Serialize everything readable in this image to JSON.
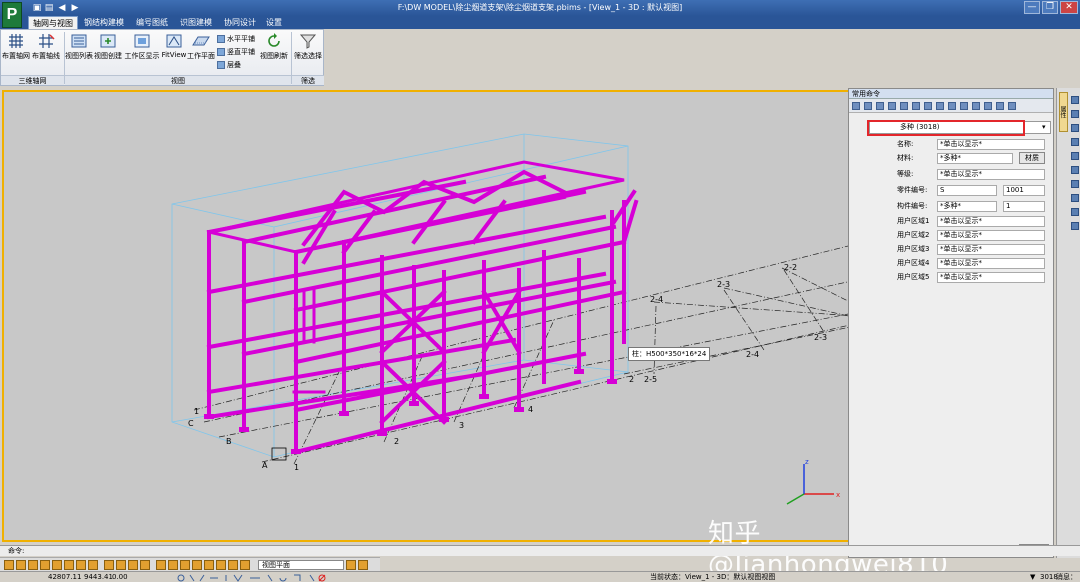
{
  "window": {
    "title": "F:\\DW MODEL\\除尘烟道支架\\除尘烟道支架.pbims - [View_1 - 3D : 默认视图]",
    "logo_letter": "P",
    "minimize": "—",
    "restore": "❐",
    "close": "✕"
  },
  "menu": {
    "tabs": [
      "轴网与视图",
      "钢结构建模",
      "编号图纸",
      "识图建模",
      "协同设计",
      "设置"
    ]
  },
  "ribbon": {
    "buttons": {
      "grid_arrange": "布置轴网",
      "grid_line": "布置轴线",
      "view_list": "视图列表",
      "view_create": "视图创建",
      "work_area": "工作区显示",
      "fitview": "FitView",
      "work_plane": "工作平面",
      "horiz_plane": "水平平铺",
      "vert_plane": "竖直平铺",
      "stack": "层叠",
      "view_refresh": "视图刷新",
      "filter_select": "筛选选择"
    },
    "groups": {
      "grid3d": "三维轴网",
      "view": "视图",
      "filter": "筛选"
    }
  },
  "viewport": {
    "tooltip": "柱：H500*350*16*24",
    "labels": [
      "2-1",
      "2-2",
      "2-3",
      "2-4",
      "B",
      "A",
      "2-2",
      "2-3",
      "2-4",
      "2-5",
      "1",
      "2",
      "3",
      "4",
      "A",
      "B",
      "C",
      "1",
      "2"
    ],
    "triad": {
      "x": "x",
      "z": "z"
    },
    "watermark": "知乎 @Jianhongwei810"
  },
  "panel": {
    "header": "常用命令",
    "selector": "多种 (3018)",
    "rows": [
      {
        "label": "名称:",
        "value": "*单击以显示*"
      },
      {
        "label": "材料:",
        "value": "*多种*",
        "button": "材质"
      },
      {
        "label": "等级:",
        "value": "*单击以显示*"
      },
      {
        "label": "零件编号:",
        "value": "S",
        "value2": "1001"
      },
      {
        "label": "构件编号:",
        "value": "*多种*",
        "value2": "1"
      },
      {
        "label": "用户区域1",
        "value": "*单击以显示*"
      },
      {
        "label": "用户区域2",
        "value": "*单击以显示*"
      },
      {
        "label": "用户区域3",
        "value": "*单击以显示*"
      },
      {
        "label": "用户区域4",
        "value": "*单击以显示*"
      },
      {
        "label": "用户区域5",
        "value": "*单击以显示*"
      }
    ],
    "modify_button": "修改",
    "side_tab": "属性"
  },
  "command": {
    "label": "命令:"
  },
  "bottom_toolbar": {
    "view_select": "视图平面"
  },
  "status": {
    "coord_x": "42807.11",
    "coord_y": "9443.41",
    "coord_z": "0.00",
    "state": "当前状态：View_1 - 3D：默认视图视图",
    "count": "3018",
    "unit": "消息："
  },
  "colors": {
    "structure": "#d600d6",
    "viewport_border": "#f0b000",
    "highlight": "#e3262b"
  }
}
